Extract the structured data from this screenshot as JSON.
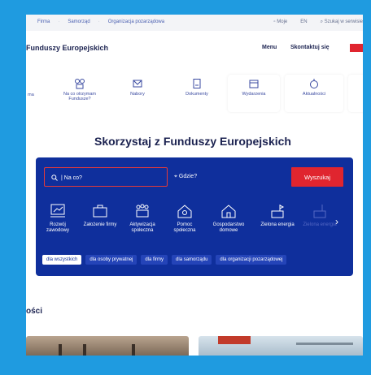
{
  "topbar": {
    "links": [
      "Firma",
      "Samorząd",
      "Organizacja pozarządowa"
    ],
    "right": [
      "Moje",
      "EN",
      "Szukaj w serwisie"
    ]
  },
  "header": {
    "site_title": "Funduszy Europejskich",
    "menu": "Menu",
    "contact": "Skontaktuj się"
  },
  "nav": {
    "cut_label": "ma",
    "items": [
      {
        "label": "Na co otrzymam Fundusze?",
        "icon": "funds-icon"
      },
      {
        "label": "Nabory",
        "icon": "calls-icon"
      },
      {
        "label": "Dokumenty",
        "icon": "documents-icon"
      },
      {
        "label": "Wydarzenia",
        "icon": "calendar-icon"
      },
      {
        "label": "Aktualności",
        "icon": "news-icon"
      }
    ]
  },
  "hero": {
    "title": "Skorzystaj z Funduszy Europejskich"
  },
  "search": {
    "what_placeholder": "| Na co?",
    "where_placeholder": "Gdzie?",
    "button": "Wyszukaj"
  },
  "categories": [
    {
      "label": "Rozwój zawodowy",
      "icon": "career-icon"
    },
    {
      "label": "Założenie firmy",
      "icon": "business-icon"
    },
    {
      "label": "Aktywizacja społeczna",
      "icon": "community-icon"
    },
    {
      "label": "Pomoc społeczna",
      "icon": "home-help-icon"
    },
    {
      "label": "Gospodarstwo domowe",
      "icon": "household-icon"
    },
    {
      "label": "Zielona energia",
      "icon": "green-energy-icon"
    },
    {
      "label": "Zielona energia",
      "icon": "green-energy-icon"
    }
  ],
  "chips": [
    "dla wszystkich",
    "dla osoby prywatnej",
    "dla firmy",
    "dla samorządu",
    "dla organizacji pozarządowej"
  ],
  "section": {
    "title": "ości"
  },
  "colors": {
    "primary": "#0f2f9c",
    "accent": "#e0252f",
    "frame": "#1f9be0"
  }
}
